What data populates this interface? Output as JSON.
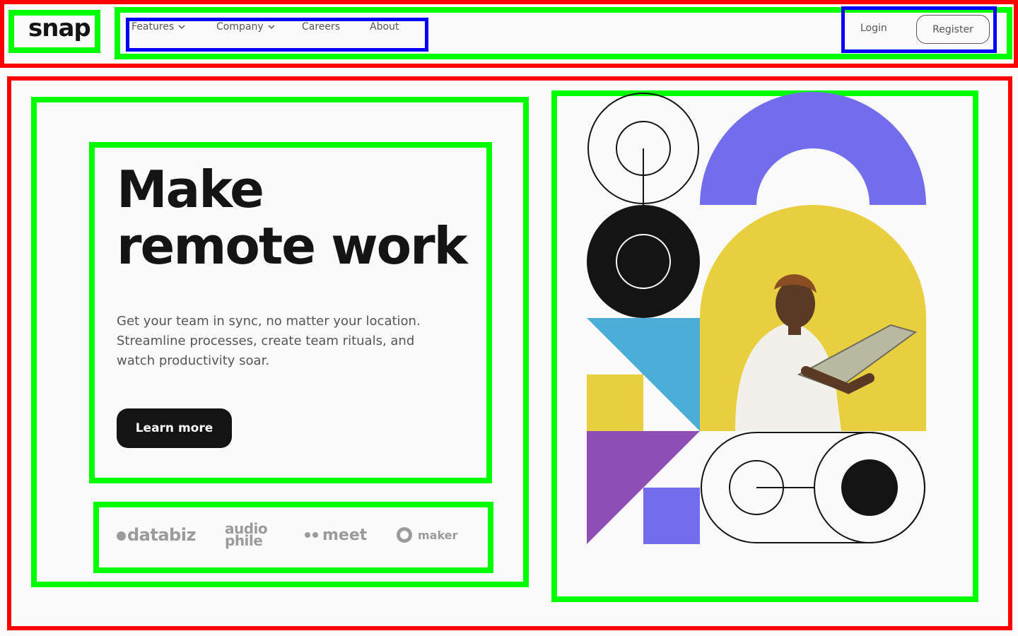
{
  "brand": {
    "logo": "snap"
  },
  "nav": {
    "items": [
      {
        "label": "Features",
        "has_dropdown": true
      },
      {
        "label": "Company",
        "has_dropdown": true
      },
      {
        "label": "Careers",
        "has_dropdown": false
      },
      {
        "label": "About",
        "has_dropdown": false
      }
    ],
    "chevron": "⌄"
  },
  "auth": {
    "login": "Login",
    "register": "Register"
  },
  "hero": {
    "headline_line1": "Make",
    "headline_line2": "remote work",
    "lead": "Get your team in sync, no matter your location. Streamline processes, create team rituals, and watch productivity soar.",
    "cta": "Learn more"
  },
  "clients": {
    "databiz": "databiz",
    "audiophile_line1": "audio",
    "audiophile_line2": "phile",
    "meet": "meet",
    "maker": "maker"
  },
  "colors": {
    "dark": "#141414",
    "text_muted": "#555555",
    "purple": "#736ded",
    "violet": "#8d4fb6",
    "yellow": "#e8cf3f",
    "blue": "#4aaed9",
    "background": "#fafafa"
  }
}
